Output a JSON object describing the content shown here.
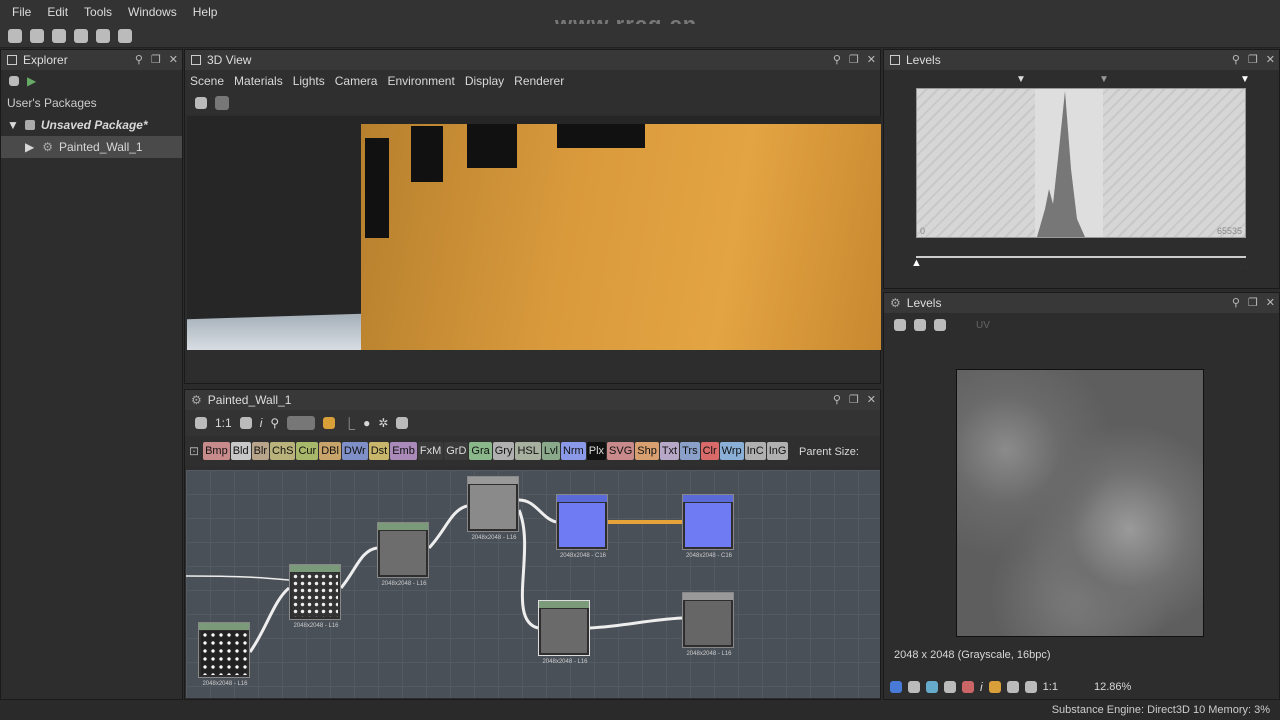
{
  "menu": [
    "File",
    "Edit",
    "Tools",
    "Windows",
    "Help"
  ],
  "watermark": "www.rrcg.cn",
  "explorer": {
    "title": "Explorer",
    "section": "User's Packages",
    "package": "Unsaved Package*",
    "graph": "Painted_Wall_1"
  },
  "view3d": {
    "title": "3D View",
    "menu": [
      "Scene",
      "Materials",
      "Lights",
      "Camera",
      "Environment",
      "Display",
      "Renderer"
    ]
  },
  "graph": {
    "title": "Painted_Wall_1",
    "zoom": "1:1",
    "parent_size": "Parent Size:",
    "libs": [
      {
        "t": "Bmp",
        "c": "#c88b8b"
      },
      {
        "t": "Bld",
        "c": "#c8c8c8"
      },
      {
        "t": "Blr",
        "c": "#b8a48a"
      },
      {
        "t": "ChS",
        "c": "#b9b27a"
      },
      {
        "t": "Cur",
        "c": "#a7b86a"
      },
      {
        "t": "DBl",
        "c": "#c9a46a"
      },
      {
        "t": "DWr",
        "c": "#7f8fc8"
      },
      {
        "t": "Dst",
        "c": "#c8b66a"
      },
      {
        "t": "Emb",
        "c": "#a98ab8"
      },
      {
        "t": "FxM",
        "c": "#3a3a3a"
      },
      {
        "t": "GrD",
        "c": "#3a3a3a"
      },
      {
        "t": "Gra",
        "c": "#8ab88a"
      },
      {
        "t": "Gry",
        "c": "#b0b0b0"
      },
      {
        "t": "HSL",
        "c": "#a8b0a0"
      },
      {
        "t": "Lvl",
        "c": "#8aa88a"
      },
      {
        "t": "Nrm",
        "c": "#8a9ae8"
      },
      {
        "t": "Plx",
        "c": "#111111"
      },
      {
        "t": "SVG",
        "c": "#c88a8a"
      },
      {
        "t": "Shp",
        "c": "#d8a070"
      },
      {
        "t": "Txt",
        "c": "#b8a8c8"
      },
      {
        "t": "Trs",
        "c": "#8aa0c8"
      },
      {
        "t": "Clr",
        "c": "#d86a6a"
      },
      {
        "t": "Wrp",
        "c": "#8ab0d8"
      },
      {
        "t": "InC",
        "c": "#b0b0b0"
      },
      {
        "t": "InG",
        "c": "#b0b0b0"
      }
    ],
    "node_labels": [
      "2048x2048 - L16",
      "2048x2048 - L16",
      "2048x2048 - L16",
      "2048x2048 - L16",
      "2048x2048 - C16",
      "2048x2048 - C16",
      "2048x2048 - L16",
      "2048x2048 - L16"
    ]
  },
  "levels_top": {
    "title": "Levels",
    "min": "0",
    "max": "65535"
  },
  "levels_bottom": {
    "title": "Levels",
    "uv": "UV",
    "info": "2048 x 2048 (Grayscale, 16bpc)",
    "zoom": "1:1",
    "percent": "12.86%"
  },
  "status": "Substance Engine: Direct3D 10  Memory: 3%"
}
